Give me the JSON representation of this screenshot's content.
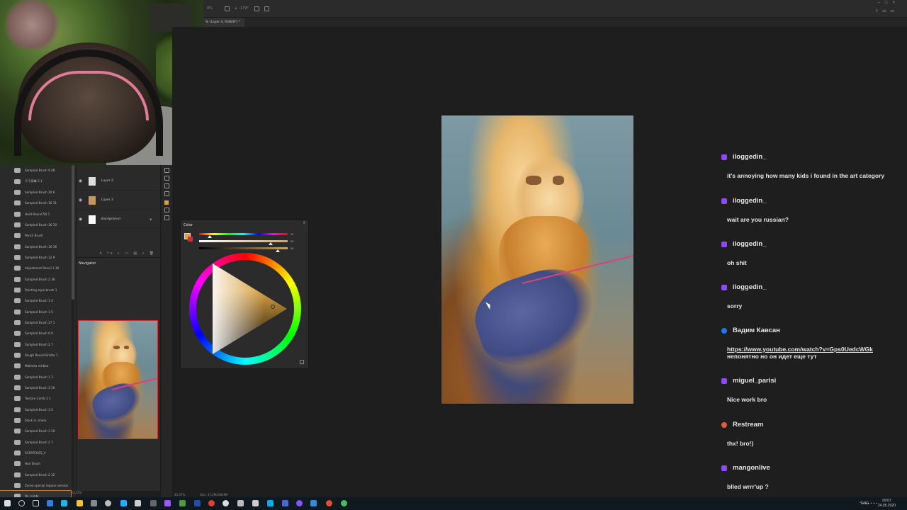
{
  "app": {
    "document_tab": "% (Layer 4, RGB/8*) *",
    "toolbar_options": [
      "0%",
      "∠ -179°"
    ]
  },
  "brushes": [
    "Sampled Brush 9 46",
    "千千高峰 2 1",
    "Sampled Brush 20 6",
    "Sampled Brush 16 11",
    "Hard Round 50 1",
    "Sampled Brush 16 10",
    "Pencil Brush",
    "Sampled Brush 16 16",
    "Sampled Brush 12 9",
    "Adjustment Pencil 1 36",
    "Sampled Brush 2 36",
    "Painting style brush 1",
    "Sampled Brush 1 4",
    "Sampled Brush 3 5",
    "Sampled Brush 27 1",
    "Sampled Brush 6 9",
    "Sampled Brush 2 7",
    "Rough Round Bristle 1",
    "Malevka mirbea",
    "Sampled Brush 1 3",
    "Sampled Brush 3 10",
    "Texture Comb 2 1",
    "Sampled Brush 3 5",
    "block in smear",
    "Sampled Brush 3 10",
    "Sampled Brush 2 7",
    "SCRATCHES_V",
    "Hair Brush",
    "Sampled Brush 2 32",
    "Zaroo-special regular version",
    "Dz. kimbi"
  ],
  "layers": [
    {
      "name": "Layer 2",
      "locked": false
    },
    {
      "name": "Layer 3",
      "locked": false
    },
    {
      "name": "Background",
      "locked": true
    }
  ],
  "navigator": {
    "title": "Navigator"
  },
  "color_panel": {
    "title": "Color",
    "values": [
      "42",
      "80",
      "88"
    ],
    "fg_color": "#e0a040",
    "bg_color": "#d03030"
  },
  "status": {
    "zoom": "33.33%",
    "zoom_main": "43.37%",
    "doc_info": "Doc: 17.2M/188.9M"
  },
  "chat": [
    {
      "platform": "twitch",
      "user": "iloggedin_",
      "text": "it's annoying how many kids i found in the art category"
    },
    {
      "platform": "twitch",
      "user": "iloggedin_",
      "text": "wait are you russian?"
    },
    {
      "platform": "twitch",
      "user": "iloggedin_",
      "text": "oh shit"
    },
    {
      "platform": "twitch",
      "user": "iloggedin_",
      "text": "sorry"
    },
    {
      "platform": "facebook",
      "user": "Вадим Кавсан",
      "link": "https://www.youtube.com/watch?v=Gps0UedcWGk",
      "text": "непонятно но он идет еще тут"
    },
    {
      "platform": "twitch",
      "user": "miguel_parisi",
      "text": "Nice work bro"
    },
    {
      "platform": "restream",
      "user": "Restream",
      "text": "thx! bro!)"
    },
    {
      "platform": "twitch",
      "user": "mangonlive",
      "text": "blled wrrr'up ?"
    }
  ],
  "colors": {
    "twitch": "#9146ff",
    "facebook": "#1877f2",
    "restream": "#e85a3a"
  },
  "taskbar": {
    "lang": "ENG",
    "time": "09:07",
    "date": "24.05.2020"
  }
}
